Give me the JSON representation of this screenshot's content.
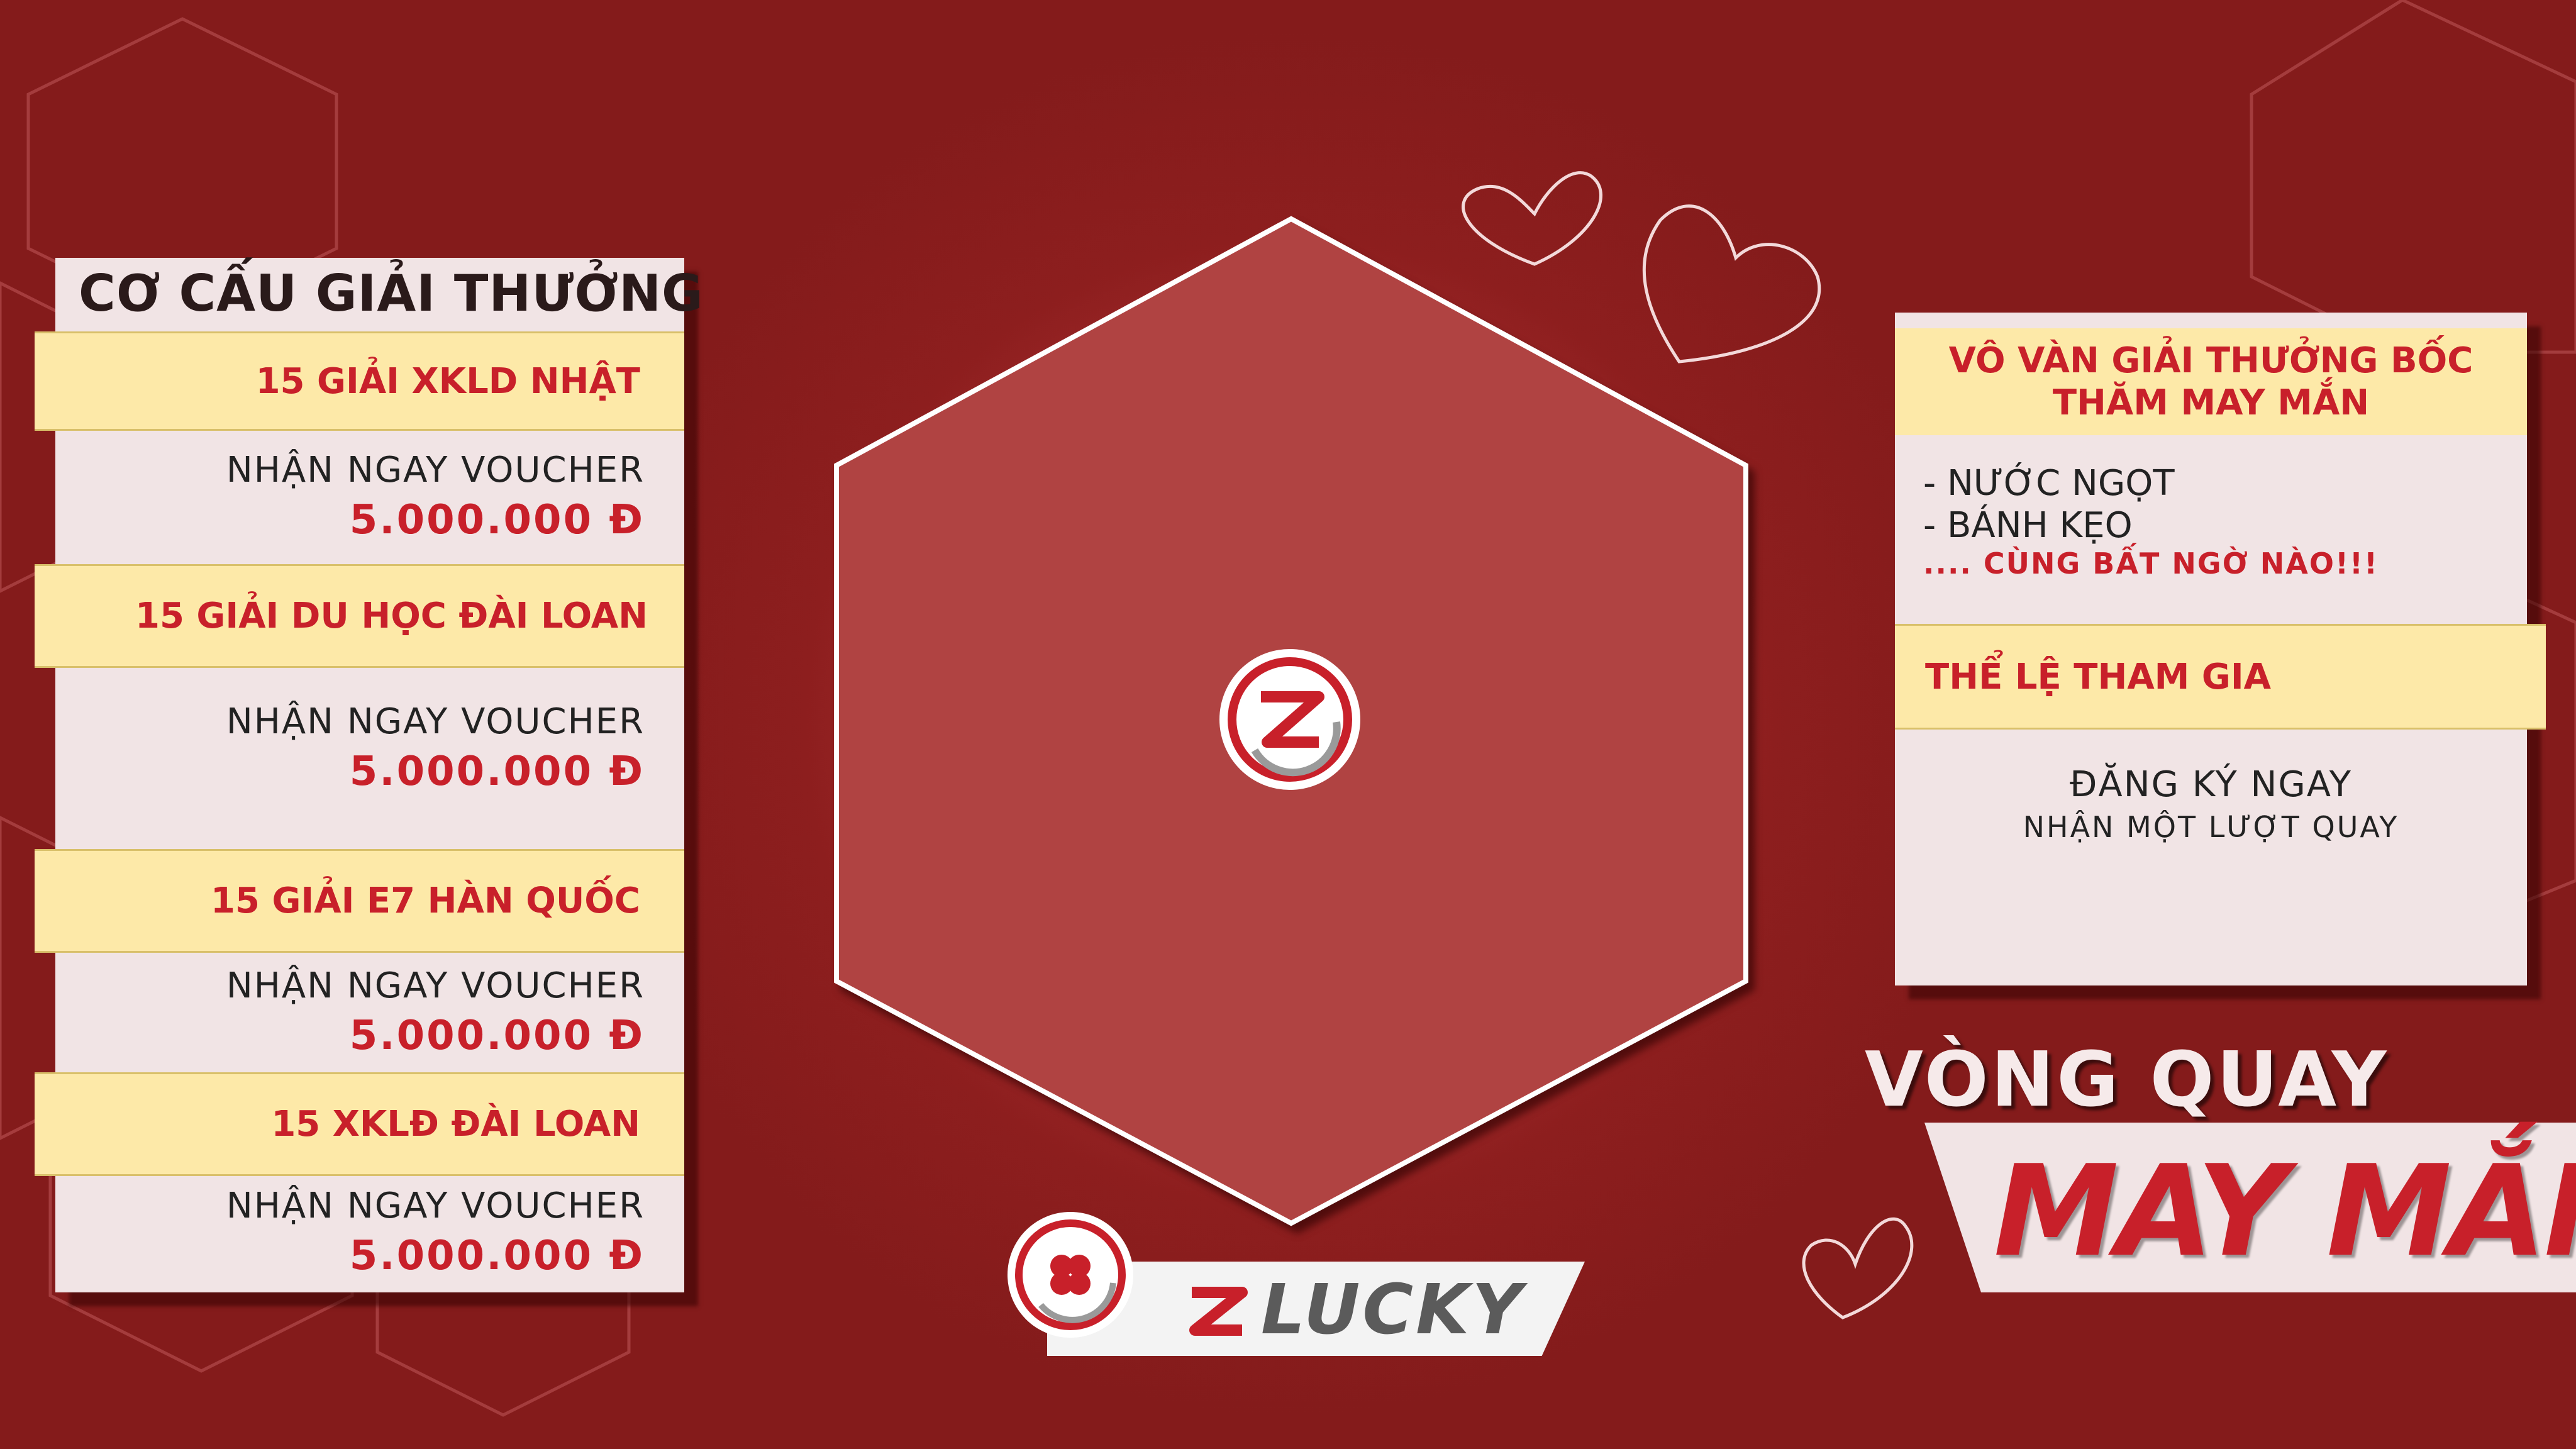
{
  "prize_structure": {
    "title": "CƠ CẤU GIẢI THƯỞNG",
    "prizes": [
      {
        "name": "15 GIẢI XKLD NHẬT",
        "voucher_label": "NHẬN NGAY VOUCHER",
        "voucher_amount": "5.000.000 Đ"
      },
      {
        "name": "15 GIẢI DU HỌC ĐÀI LOAN",
        "voucher_label": "NHẬN NGAY VOUCHER",
        "voucher_amount": "5.000.000 Đ"
      },
      {
        "name": "15 GIẢI E7 HÀN QUỐC",
        "voucher_label": "NHẬN NGAY VOUCHER",
        "voucher_amount": "5.000.000 Đ"
      },
      {
        "name": "15 XKLĐ ĐÀI LOAN",
        "voucher_label": "NHẬN NGAY VOUCHER",
        "voucher_amount": "5.000.000 Đ"
      }
    ]
  },
  "lucky_draw": {
    "title": "VÔ VÀN GIẢI THƯỞNG BỐC THĂM MAY MẮN",
    "items": [
      "- NƯỚC NGỌT",
      "- BÁNH KẸO"
    ],
    "surprise": ".... CÙNG BẤT NGỜ NÀO!!!"
  },
  "rules": {
    "title": "THỂ LỆ THAM GIA",
    "line1": "ĐĂNG KÝ NGAY",
    "line2": "NHẬN MỘT LƯỢT QUAY"
  },
  "wheel": {
    "title_top": "VÒNG QUAY",
    "title_bottom": "MAY MẮN",
    "center_icon": "z-logo-icon"
  },
  "brand": {
    "name": "LUCKY",
    "logo_icon": "clover-logo-icon"
  },
  "colors": {
    "background": "#8d1e1e",
    "accent_red": "#c8202a",
    "band_yellow": "#fde9a8",
    "panel": "#f1e4e5"
  }
}
